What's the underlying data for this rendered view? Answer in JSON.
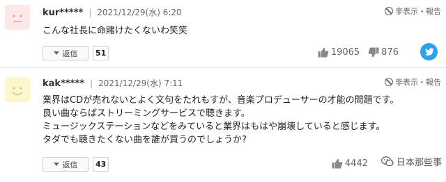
{
  "comments": [
    {
      "username": "kur*****",
      "date": "2021/12/29(水) 6:20",
      "report_label": "非表示・報告",
      "text_lines": [
        "こんな社長に命賭けたくないわ笑笑"
      ],
      "reply_label": "返信",
      "reply_count": "51",
      "likes": "19065",
      "dislikes": "876",
      "avatar_color": "#fde8e8",
      "avatar_face": "neutral"
    },
    {
      "username": "kak*****",
      "date": "2021/12/29(水) 7:11",
      "report_label": "非表示・報告",
      "text_lines": [
        "業界はCDが売れないとよく文句をたれもすが、音楽プロデューサーの才能の問題です。",
        "良い曲ならばストリーミングサービスで聴きます。",
        "ミュージックステーションなどをみていると業界はもはや崩壊していると感じます。",
        "タダでも聴きたくない曲を誰が買うのでしょうか?"
      ],
      "reply_label": "返信",
      "reply_count": "43",
      "likes": "4442",
      "avatar_color": "#fdf6cf",
      "avatar_face": "smile"
    }
  ],
  "share": {
    "icon": "twitter-icon",
    "color": "#2aa3ef"
  },
  "watermark": {
    "text": "日本那些事",
    "icon": "wechat-icon"
  },
  "colors": {
    "separator": "#e3e3e3",
    "text": "#222222",
    "muted": "#666666"
  }
}
